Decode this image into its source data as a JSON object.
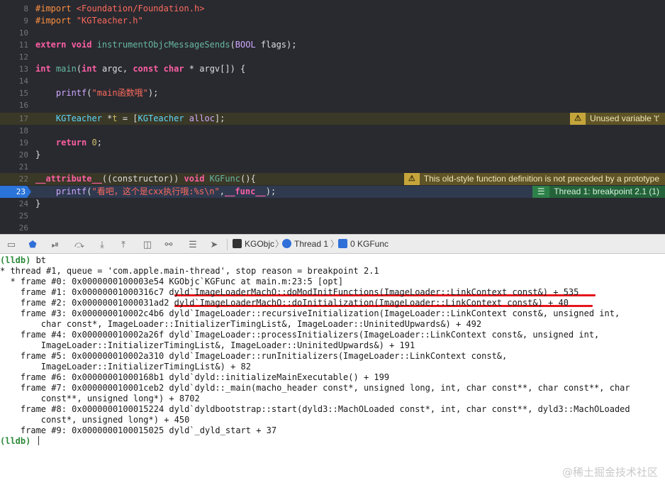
{
  "editor": {
    "lines": [
      {
        "num": "8",
        "segments": [
          {
            "t": "#import ",
            "c": "pp"
          },
          {
            "t": "<Foundation/Foundation.h>",
            "c": "str"
          }
        ]
      },
      {
        "num": "9",
        "segments": [
          {
            "t": "#import ",
            "c": "pp"
          },
          {
            "t": "\"KGTeacher.h\"",
            "c": "str"
          }
        ]
      },
      {
        "num": "10",
        "segments": []
      },
      {
        "num": "11",
        "segments": [
          {
            "t": "extern ",
            "c": "kw"
          },
          {
            "t": "void ",
            "c": "kw"
          },
          {
            "t": "instrumentObjcMessageSends",
            "c": "fn"
          },
          {
            "t": "(",
            "c": "plain"
          },
          {
            "t": "BOOL",
            "c": "ty"
          },
          {
            "t": " flags);",
            "c": "plain"
          }
        ]
      },
      {
        "num": "12",
        "segments": []
      },
      {
        "num": "13",
        "segments": [
          {
            "t": "int ",
            "c": "kw"
          },
          {
            "t": "main",
            "c": "fn"
          },
          {
            "t": "(",
            "c": "plain"
          },
          {
            "t": "int ",
            "c": "kw"
          },
          {
            "t": "argc, ",
            "c": "plain"
          },
          {
            "t": "const ",
            "c": "kw"
          },
          {
            "t": "char ",
            "c": "kw"
          },
          {
            "t": "* argv[]) {",
            "c": "plain"
          }
        ]
      },
      {
        "num": "14",
        "segments": []
      },
      {
        "num": "15",
        "segments": [
          {
            "t": "    ",
            "c": "plain"
          },
          {
            "t": "printf",
            "c": "ty"
          },
          {
            "t": "(",
            "c": "plain"
          },
          {
            "t": "\"main函数哦\"",
            "c": "str"
          },
          {
            "t": ");",
            "c": "plain"
          }
        ]
      },
      {
        "num": "16",
        "segments": []
      },
      {
        "num": "17",
        "segments": [
          {
            "t": "    ",
            "c": "plain"
          },
          {
            "t": "KGTeacher",
            "c": "cls"
          },
          {
            "t": " *",
            "c": "plain"
          },
          {
            "t": "t",
            "c": "num"
          },
          {
            "t": " = [",
            "c": "plain"
          },
          {
            "t": "KGTeacher",
            "c": "cls"
          },
          {
            "t": " ",
            "c": "plain"
          },
          {
            "t": "alloc",
            "c": "ty"
          },
          {
            "t": "];",
            "c": "plain"
          }
        ]
      },
      {
        "num": "18",
        "segments": []
      },
      {
        "num": "19",
        "segments": [
          {
            "t": "    ",
            "c": "plain"
          },
          {
            "t": "return ",
            "c": "kw"
          },
          {
            "t": "0",
            "c": "num"
          },
          {
            "t": ";",
            "c": "plain"
          }
        ]
      },
      {
        "num": "20",
        "segments": [
          {
            "t": "}",
            "c": "plain"
          }
        ]
      },
      {
        "num": "21",
        "segments": []
      },
      {
        "num": "22",
        "segments": [
          {
            "t": "__attribute__",
            "c": "kw"
          },
          {
            "t": "((constructor)) ",
            "c": "plain"
          },
          {
            "t": "void ",
            "c": "kw"
          },
          {
            "t": "KGFunc",
            "c": "fn"
          },
          {
            "t": "(){",
            "c": "plain"
          }
        ]
      },
      {
        "num": "23",
        "segments": [
          {
            "t": "    ",
            "c": "plain"
          },
          {
            "t": "printf",
            "c": "ty"
          },
          {
            "t": "(",
            "c": "plain"
          },
          {
            "t": "\"看吧，这个是cxx执行哦:%s\\n\"",
            "c": "str"
          },
          {
            "t": ",",
            "c": "plain"
          },
          {
            "t": "__func__",
            "c": "kw"
          },
          {
            "t": ");",
            "c": "plain"
          }
        ]
      },
      {
        "num": "24",
        "segments": [
          {
            "t": "}",
            "c": "plain"
          }
        ]
      },
      {
        "num": "25",
        "segments": []
      },
      {
        "num": "26",
        "segments": []
      }
    ],
    "warning_1": "Unused variable 't'",
    "warning_2": "This old-style function definition is not preceded by a prototype",
    "breakpoint_badge": "Thread 1: breakpoint 2.1 (1)",
    "current_line": "23"
  },
  "toolbar": {
    "target": "KGObjc",
    "thread": "Thread 1",
    "frame": "0 KGFunc"
  },
  "console": {
    "lines": [
      {
        "p": "(lldb) ",
        "t": "bt"
      },
      {
        "p": "",
        "t": "* thread #1, queue = 'com.apple.main-thread', stop reason = breakpoint 2.1"
      },
      {
        "p": "",
        "t": "  * frame #0: 0x0000000100003e54 KGObjc`KGFunc at main.m:23:5 [opt]"
      },
      {
        "p": "",
        "t": "    frame #1: 0x00000001000316c7 dyld`ImageLoaderMachO::doModInitFunctions(ImageLoader::LinkContext const&) + 535"
      },
      {
        "p": "",
        "t": "    frame #2: 0x00000001000031ad2 dyld`ImageLoaderMachO::doInitialization(ImageLoader::LinkContext const&) + 40"
      },
      {
        "p": "",
        "t": "    frame #3: 0x000000010002c4b6 dyld`ImageLoader::recursiveInitialization(ImageLoader::LinkContext const&, unsigned int,"
      },
      {
        "p": "",
        "t": "        char const*, ImageLoader::InitializerTimingList&, ImageLoader::UninitedUpwards&) + 492"
      },
      {
        "p": "",
        "t": "    frame #4: 0x000000010002a26f dyld`ImageLoader::processInitializers(ImageLoader::LinkContext const&, unsigned int,"
      },
      {
        "p": "",
        "t": "        ImageLoader::InitializerTimingList&, ImageLoader::UninitedUpwards&) + 191"
      },
      {
        "p": "",
        "t": "    frame #5: 0x000000010002a310 dyld`ImageLoader::runInitializers(ImageLoader::LinkContext const&,"
      },
      {
        "p": "",
        "t": "        ImageLoader::InitializerTimingList&) + 82"
      },
      {
        "p": "",
        "t": "    frame #6: 0x00000001000168b1 dyld`dyld::initializeMainExecutable() + 199"
      },
      {
        "p": "",
        "t": "    frame #7: 0x000000010001ceb2 dyld`dyld::_main(macho_header const*, unsigned long, int, char const**, char const**, char"
      },
      {
        "p": "",
        "t": "        const**, unsigned long*) + 8702"
      },
      {
        "p": "",
        "t": "    frame #8: 0x0000000100015224 dyld`dyldbootstrap::start(dyld3::MachOLoaded const*, int, char const**, dyld3::MachOLoaded"
      },
      {
        "p": "",
        "t": "        const*, unsigned long*) + 450"
      },
      {
        "p": "",
        "t": "    frame #9: 0x0000000100015025 dyld`_dyld_start + 37"
      },
      {
        "p": "(lldb) ",
        "t": ""
      }
    ]
  },
  "watermark": "@稀土掘金技术社区",
  "colors": {
    "accent": "#2a73d8",
    "warning": "#c5a53b",
    "breakpoint_ok": "#24633a",
    "underline": "#e5161a"
  }
}
